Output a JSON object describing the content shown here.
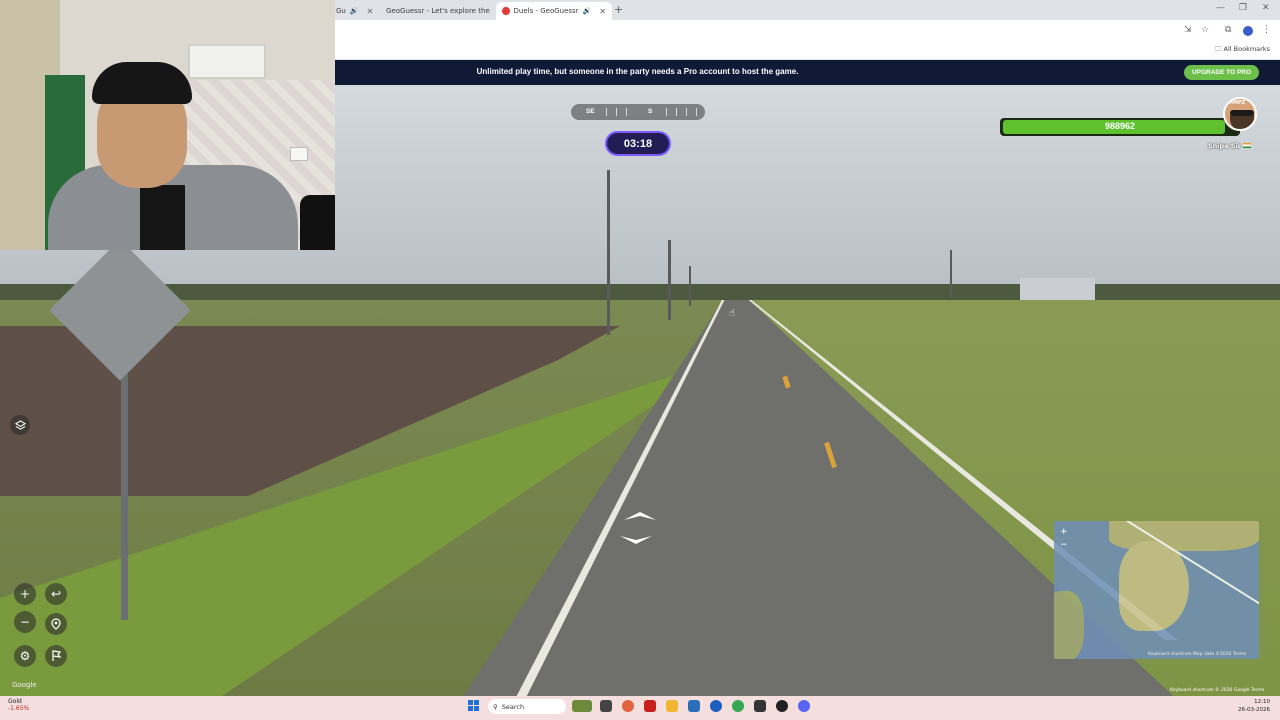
{
  "browser": {
    "tabs": [
      {
        "label": "Gu"
      },
      {
        "label": "GeoGuessr - Let's explore the"
      },
      {
        "label": "Duels - GeoGuessr"
      }
    ],
    "bookmarks_label": "All Bookmarks"
  },
  "banner": {
    "message": "Unlimited play time, but someone in the party needs a Pro account to host the game.",
    "upgrade_label": "UPGRADE TO PRO"
  },
  "compass": {
    "left": "SE",
    "center": "S"
  },
  "timer": {
    "value": "03:18"
  },
  "player": {
    "health": "988962",
    "health_fraction": 0.95,
    "name": "Snipe Sir",
    "avatar_tag": "MMPZ",
    "colors": {
      "health_bar": "#5fc12e",
      "accent": "#7a5cff",
      "banner": "#101a37"
    }
  },
  "map": {
    "zoom_in": "+",
    "zoom_out": "−",
    "footer": "Keyboard shortcuts  Map data ©2026  Terms",
    "bottom_credit": "Keyboard shortcuts  © 2026 Google  Terms",
    "google_mark": "Google"
  },
  "taskbar": {
    "ticker_name": "Gold",
    "ticker_change": "-1.65%",
    "search_placeholder": "Search",
    "time": "12:10",
    "date": "26-03-2026"
  }
}
